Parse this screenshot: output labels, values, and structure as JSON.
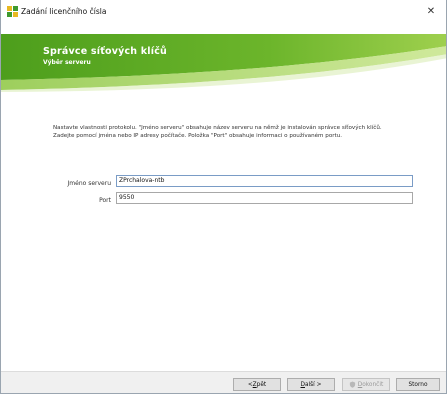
{
  "window": {
    "title": "Zadání licenčního čísla",
    "close_glyph": "✕"
  },
  "header": {
    "title": "Správce síťových klíčů",
    "subtitle": "Výběr serveru",
    "colors": {
      "green_dark": "#5aa822",
      "green_light": "#a8d35a"
    }
  },
  "description": "Nastavte vlastnosti protokolu. \"Jméno serveru\" obsahuje název serveru na němž je instalován správce síťových klíčů. Zadejte pomocí jména nebo IP adresy počítače. Položka \"Port\" obsahuje informaci o používaném portu.",
  "form": {
    "server_label": "Jméno serveru",
    "server_value": "ZPrchalova-ntb",
    "port_label": "Port",
    "port_value": "9550"
  },
  "buttons": {
    "back_prefix": "< ",
    "back_u": "Z",
    "back_rest": "pět",
    "next_u": "D",
    "next_rest": "alší >",
    "finish_icon": "shield-icon",
    "finish_u": "D",
    "finish_rest": "okončit",
    "cancel": "Storno"
  }
}
